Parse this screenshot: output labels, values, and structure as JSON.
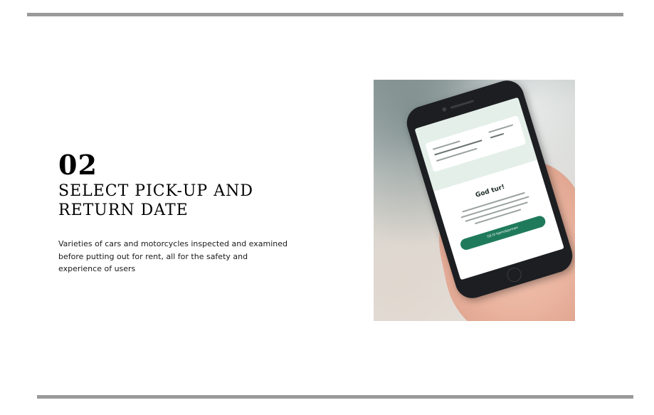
{
  "slide": {
    "step_number": "02",
    "title": "SELECT PICK-UP AND RETURN DATE",
    "description": "Varieties of cars and motorcycles inspected and examined before putting out for rent, all for the safety and experience of users"
  },
  "phone_screen": {
    "heading": "God tur!",
    "button_label": "Gå til hjemskjermen"
  },
  "colors": {
    "rule": "#9a9a9a",
    "screen_accent": "#1f7a5c",
    "screen_header": "#e4efe9"
  },
  "icons": [
    "phone-photo",
    "home-button-icon",
    "camera-icon"
  ]
}
